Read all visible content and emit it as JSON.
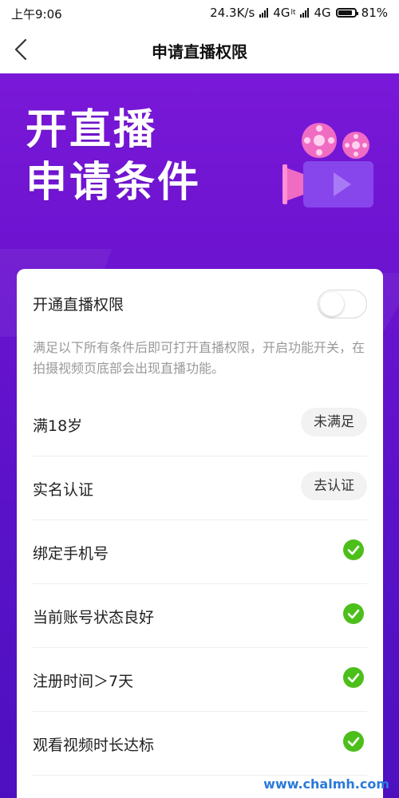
{
  "status_bar": {
    "time": "上午9:06",
    "speed": "24.3K/s",
    "net1": "4G",
    "net1_sub": "lt",
    "net2": "4G",
    "battery": "81%",
    "battery_level": 0.81
  },
  "nav": {
    "back_icon": "chevron-left-icon",
    "title": "申请直播权限"
  },
  "hero": {
    "title_line1": "开直播",
    "title_line2": "申请条件",
    "illustration": "movie-camera-icon"
  },
  "toggle_row": {
    "label": "开通直播权限",
    "enabled": false
  },
  "description": "满足以下所有条件后即可打开直播权限，开启功能开关，在拍摄视频页底部会出现直播功能。",
  "conditions": [
    {
      "label": "满18岁",
      "action": "未满足",
      "type": "button"
    },
    {
      "label": "实名认证",
      "action": "去认证",
      "type": "button"
    },
    {
      "label": "绑定手机号",
      "type": "check",
      "icon": "check-circle-icon"
    },
    {
      "label": "当前账号状态良好",
      "type": "check",
      "icon": "check-circle-icon"
    },
    {
      "label": "注册时间＞7天",
      "type": "check",
      "icon": "check-circle-icon"
    },
    {
      "label": "观看视频时长达标",
      "type": "check",
      "icon": "check-circle-icon"
    }
  ],
  "watermark": "www.chalmh.com",
  "colors": {
    "hero_purple": "#6a13cf",
    "check_green": "#4cbf1a",
    "watermark_blue": "#2a7ad9"
  }
}
